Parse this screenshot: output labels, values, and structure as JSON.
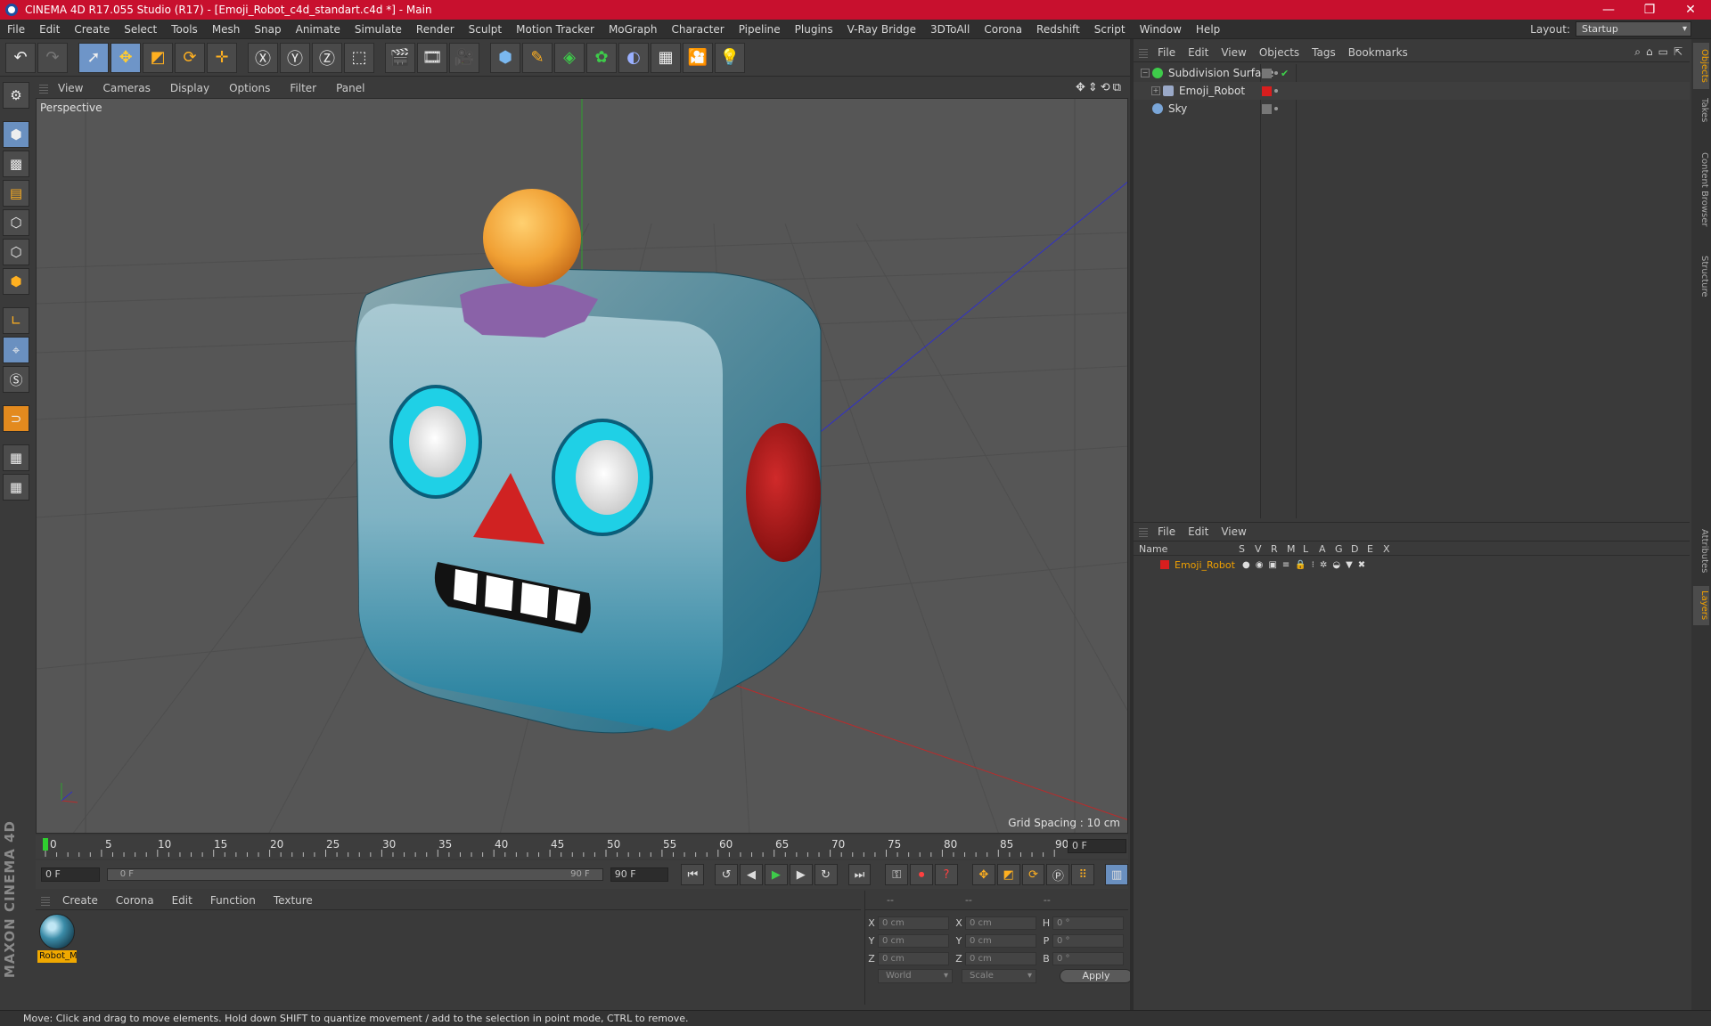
{
  "window": {
    "title": "CINEMA 4D R17.055 Studio (R17) - [Emoji_Robot_c4d_standart.c4d *] - Main",
    "minimize": "—",
    "maximize": "❐",
    "close": "✕"
  },
  "menu": [
    "File",
    "Edit",
    "Create",
    "Select",
    "Tools",
    "Mesh",
    "Snap",
    "Animate",
    "Simulate",
    "Render",
    "Sculpt",
    "Motion Tracker",
    "MoGraph",
    "Character",
    "Pipeline",
    "Plugins",
    "V-Ray Bridge",
    "3DToAll",
    "Corona",
    "Redshift",
    "Script",
    "Window",
    "Help"
  ],
  "layout": {
    "label": "Layout:",
    "value": "Startup"
  },
  "viewport": {
    "menu": [
      "View",
      "Cameras",
      "Display",
      "Options",
      "Filter",
      "Panel"
    ],
    "camera_label": "Perspective",
    "grid_spacing": "Grid Spacing : 10 cm"
  },
  "timeline": {
    "ticks": [
      "0",
      "5",
      "10",
      "15",
      "20",
      "25",
      "30",
      "35",
      "40",
      "45",
      "50",
      "55",
      "60",
      "65",
      "70",
      "75",
      "80",
      "85",
      "90"
    ],
    "current_frame": "0 F",
    "start_field": "0 F",
    "slider_start": "0 F",
    "slider_end": "90 F",
    "end_field": "90 F"
  },
  "materials": {
    "menu": [
      "Create",
      "Corona",
      "Edit",
      "Function",
      "Texture"
    ],
    "items": [
      {
        "name": "Robot_M"
      }
    ]
  },
  "coordinates": {
    "headers": [
      "--",
      "--",
      "--"
    ],
    "rows": [
      {
        "a": "X",
        "av": "0 cm",
        "b": "X",
        "bv": "0 cm",
        "c": "H",
        "cv": "0 °"
      },
      {
        "a": "Y",
        "av": "0 cm",
        "b": "Y",
        "bv": "0 cm",
        "c": "P",
        "cv": "0 °"
      },
      {
        "a": "Z",
        "av": "0 cm",
        "b": "Z",
        "bv": "0 cm",
        "c": "B",
        "cv": "0 °"
      }
    ],
    "space": "World",
    "mode": "Scale",
    "apply": "Apply"
  },
  "objects": {
    "menu": [
      "File",
      "Edit",
      "View",
      "Objects",
      "Tags",
      "Bookmarks"
    ],
    "items": [
      {
        "name": "Subdivision Surface",
        "icon_color": "#3ecb4a"
      },
      {
        "name": "Emoji_Robot",
        "icon_color": "#9aa9c8"
      },
      {
        "name": "Sky",
        "icon_color": "#7aa6d8"
      }
    ]
  },
  "layers": {
    "menu": [
      "File",
      "Edit",
      "View"
    ],
    "columns": [
      "Name",
      "S",
      "V",
      "R",
      "M",
      "L",
      "A",
      "G",
      "D",
      "E",
      "X"
    ],
    "items": [
      {
        "name": "Emoji_Robot",
        "color": "#d81e1e"
      }
    ]
  },
  "side_tabs": [
    "Objects",
    "Takes",
    "Content Browser",
    "Structure",
    "Attributes",
    "Layers"
  ],
  "status": "Move: Click and drag to move elements. Hold down SHIFT to quantize movement / add to the selection in point mode, CTRL to remove."
}
